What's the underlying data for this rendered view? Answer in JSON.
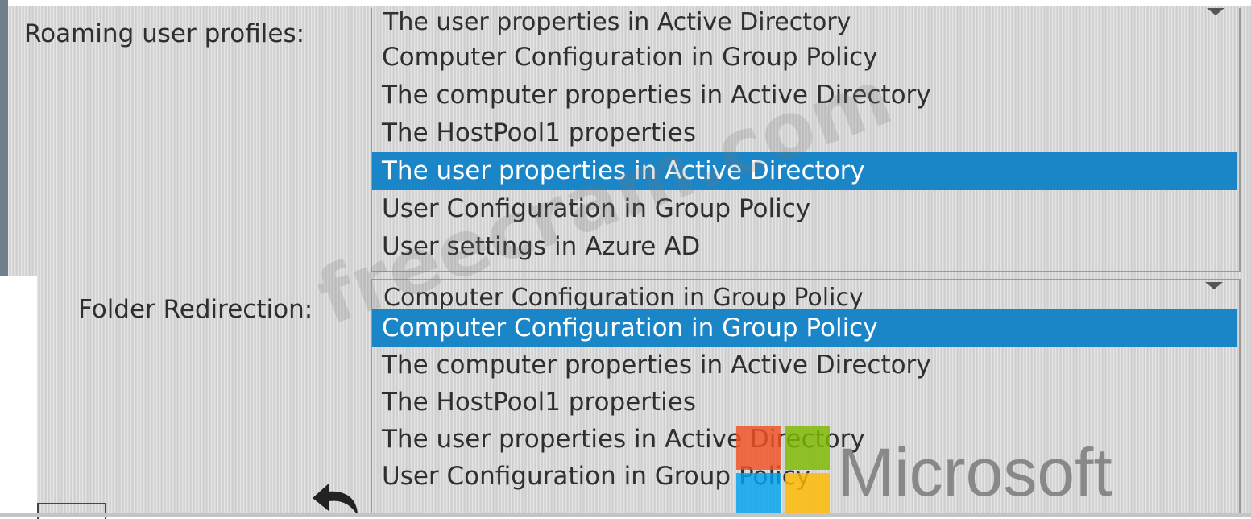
{
  "roaming": {
    "label": "Roaming user profiles:",
    "selected": "The user properties in Active Directory",
    "options": [
      "Computer Configuration in Group Policy",
      "The computer properties in Active Directory",
      "The HostPool1 properties",
      "The user properties in Active Directory",
      "User Configuration in Group Policy",
      "User settings in Azure AD"
    ],
    "highlighted_index": 3
  },
  "folder": {
    "label": "Folder Redirection:",
    "selected": "Computer Configuration in Group Policy",
    "options": [
      "Computer Configuration in Group Policy",
      "The computer properties in Active Directory",
      "The HostPool1 properties",
      "The user properties in Active Directory",
      "User Configuration in Group Policy"
    ],
    "highlighted_index": 0
  },
  "watermark": {
    "text": "freecram.com"
  },
  "logo": {
    "text": "Microsoft",
    "icon": "microsoft-logo-icon"
  },
  "colors": {
    "highlight": "#1a86c8",
    "panel": "#d6d6d6"
  },
  "icons": {
    "back": "undo-arrow-icon",
    "dropdown": "chevron-down-icon"
  }
}
